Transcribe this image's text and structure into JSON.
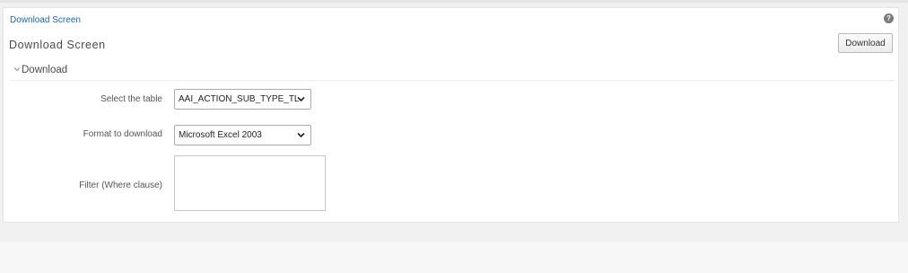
{
  "breadcrumb": {
    "label": "Download Screen"
  },
  "header": {
    "title": "Download Screen",
    "download_button_label": "Download",
    "help_icon_glyph": "?"
  },
  "section": {
    "title": "Download"
  },
  "form": {
    "table_label": "Select the table",
    "table_value": "AAI_ACTION_SUB_TYPE_TL",
    "format_label": "Format to download",
    "format_value": "Microsoft Excel 2003",
    "filter_label": "Filter (Where clause)",
    "filter_value": ""
  },
  "colors": {
    "link": "#1d66a8",
    "panel_background": "#ffffff",
    "page_background": "#f1f1f1"
  }
}
